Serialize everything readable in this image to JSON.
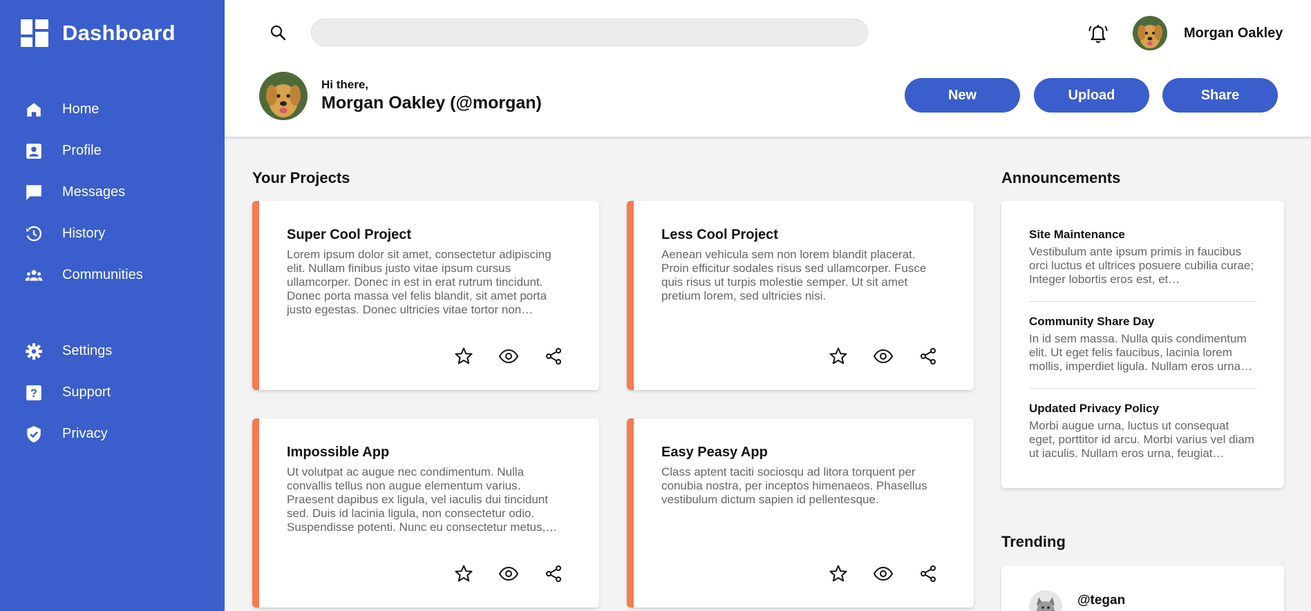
{
  "sidebar": {
    "brand": "Dashboard",
    "items": [
      {
        "label": "Home",
        "icon": "home-icon"
      },
      {
        "label": "Profile",
        "icon": "profile-icon"
      },
      {
        "label": "Messages",
        "icon": "messages-icon"
      },
      {
        "label": "History",
        "icon": "history-icon"
      },
      {
        "label": "Communities",
        "icon": "communities-icon"
      },
      {
        "label": "Settings",
        "icon": "gear-icon"
      },
      {
        "label": "Support",
        "icon": "help-icon"
      },
      {
        "label": "Privacy",
        "icon": "shield-icon"
      }
    ]
  },
  "header": {
    "search": {
      "value": "",
      "placeholder": ""
    },
    "username": "Morgan Oakley",
    "greeting": "Hi there,",
    "full_name": "Morgan Oakley (@morgan)",
    "buttons": {
      "new": "New",
      "upload": "Upload",
      "share": "Share"
    }
  },
  "projects": {
    "title": "Your Projects",
    "cards": [
      {
        "title": "Super Cool Project",
        "description": "Lorem ipsum dolor sit amet, consectetur adipiscing elit. Nullam finibus justo vitae ipsum cursus ullamcorper. Donec in est in erat rutrum tincidunt. Donec porta massa vel felis blandit, sit amet porta justo egestas. Donec ultricies vitae tortor non…"
      },
      {
        "title": "Less Cool Project",
        "description": "Aenean vehicula sem non lorem blandit placerat. Proin efficitur sodales risus sed ullamcorper. Fusce quis risus ut turpis molestie semper. Ut sit amet pretium lorem, sed ultricies nisi."
      },
      {
        "title": "Impossible App",
        "description": "Ut volutpat ac augue nec condimentum. Nulla convallis tellus non augue elementum varius. Praesent dapibus ex ligula, vel iaculis dui tincidunt sed. Duis id lacinia ligula, non consectetur odio. Suspendisse potenti. Nunc eu consectetur metus,…"
      },
      {
        "title": "Easy Peasy App",
        "description": "Class aptent taciti sociosqu ad litora torquent per conubia nostra, per inceptos himenaeos. Phasellus vestibulum dictum sapien id pellentesque."
      }
    ]
  },
  "announcements": {
    "title": "Announcements",
    "items": [
      {
        "title": "Site Maintenance",
        "text": "Vestibulum ante ipsum primis in faucibus orci luctus et ultrices posuere cubilia curae; Integer lobortis eros est, et…"
      },
      {
        "title": "Community Share Day",
        "text": "In id sem massa. Nulla quis condimentum elit. Ut eget felis faucibus, lacinia lorem mollis, imperdiet ligula. Nullam eros urna…"
      },
      {
        "title": "Updated Privacy Policy",
        "text": "Morbi augue urna, luctus ut consequat eget, porttitor id arcu. Morbi varius vel diam ut iaculis. Nullam eros urna, feugiat…"
      }
    ]
  },
  "trending": {
    "title": "Trending",
    "items": [
      {
        "handle": "@tegan"
      }
    ]
  },
  "colors": {
    "primary": "#3a5ecc",
    "accent": "#f47c4e",
    "background": "#f3f3f3"
  }
}
